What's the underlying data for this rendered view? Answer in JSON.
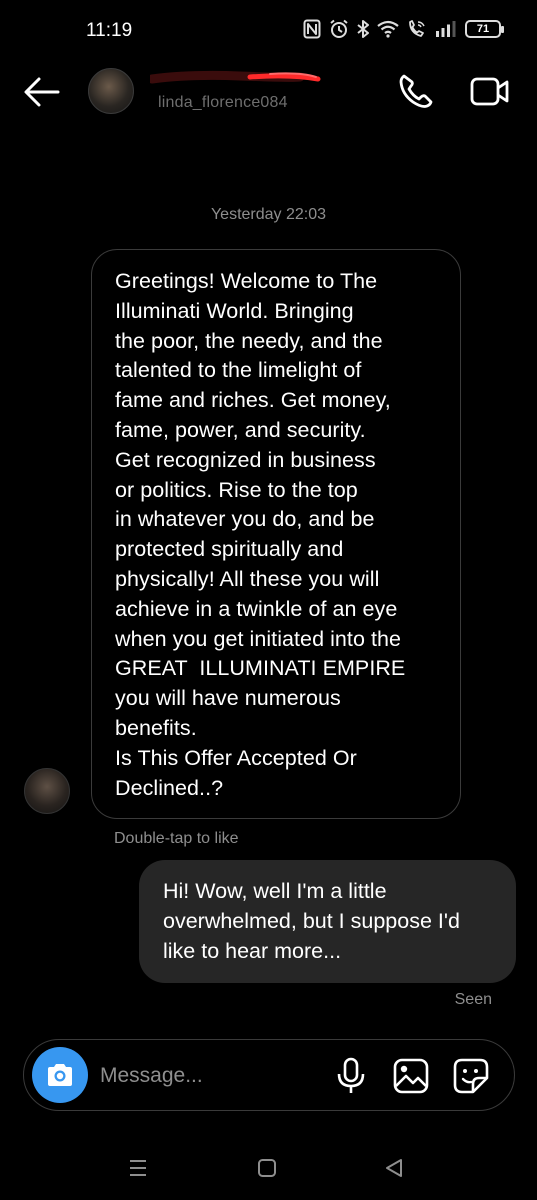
{
  "status_bar": {
    "time": "11:19",
    "battery": "71",
    "icons": [
      "nfc-icon",
      "alarm-icon",
      "bluetooth-icon",
      "wifi-icon",
      "wifi-calling-icon",
      "signal-icon",
      "battery-icon"
    ]
  },
  "header": {
    "username": "linda_florence084",
    "icons": [
      "back-arrow-icon",
      "phone-icon",
      "video-camera-icon"
    ]
  },
  "chat": {
    "timestamp": "Yesterday 22:03",
    "incoming_message": {
      "lines": [
        "Greetings! Welcome to The",
        "Illuminati World. Bringing",
        "the poor, the needy, and the",
        "talented to the limelight of",
        "fame and riches. Get money,",
        "fame, power, and security.",
        "Get recognized in business",
        "or politics. Rise to the top",
        "in whatever you do, and be",
        "protected spiritually and",
        "physically! All these you will",
        "achieve in a twinkle of an eye",
        "when you get initiated into the",
        "GREAT  ILLUMINATI EMPIRE",
        "you will have numerous",
        "benefits.",
        "Is This Offer Accepted Or",
        "Declined..?"
      ]
    },
    "double_tap_hint": "Double-tap to like",
    "outgoing_message": {
      "lines": [
        "Hi! Wow, well I'm a little",
        "overwhelmed, but I suppose I'd",
        "like to hear more..."
      ]
    },
    "seen_label": "Seen"
  },
  "composer": {
    "placeholder": "Message...",
    "icons": [
      "camera-icon",
      "microphone-icon",
      "gallery-icon",
      "sticker-icon"
    ],
    "camera_color": "#3797f0"
  },
  "nav_bar": {
    "icons": [
      "recent-apps-icon",
      "home-icon",
      "back-icon"
    ]
  },
  "colors": {
    "background": "#000000",
    "outgoing_bubble": "#262626",
    "incoming_border": "#3b3b3b",
    "secondary_text": "#8e8e8e",
    "accent": "#3797f0"
  }
}
